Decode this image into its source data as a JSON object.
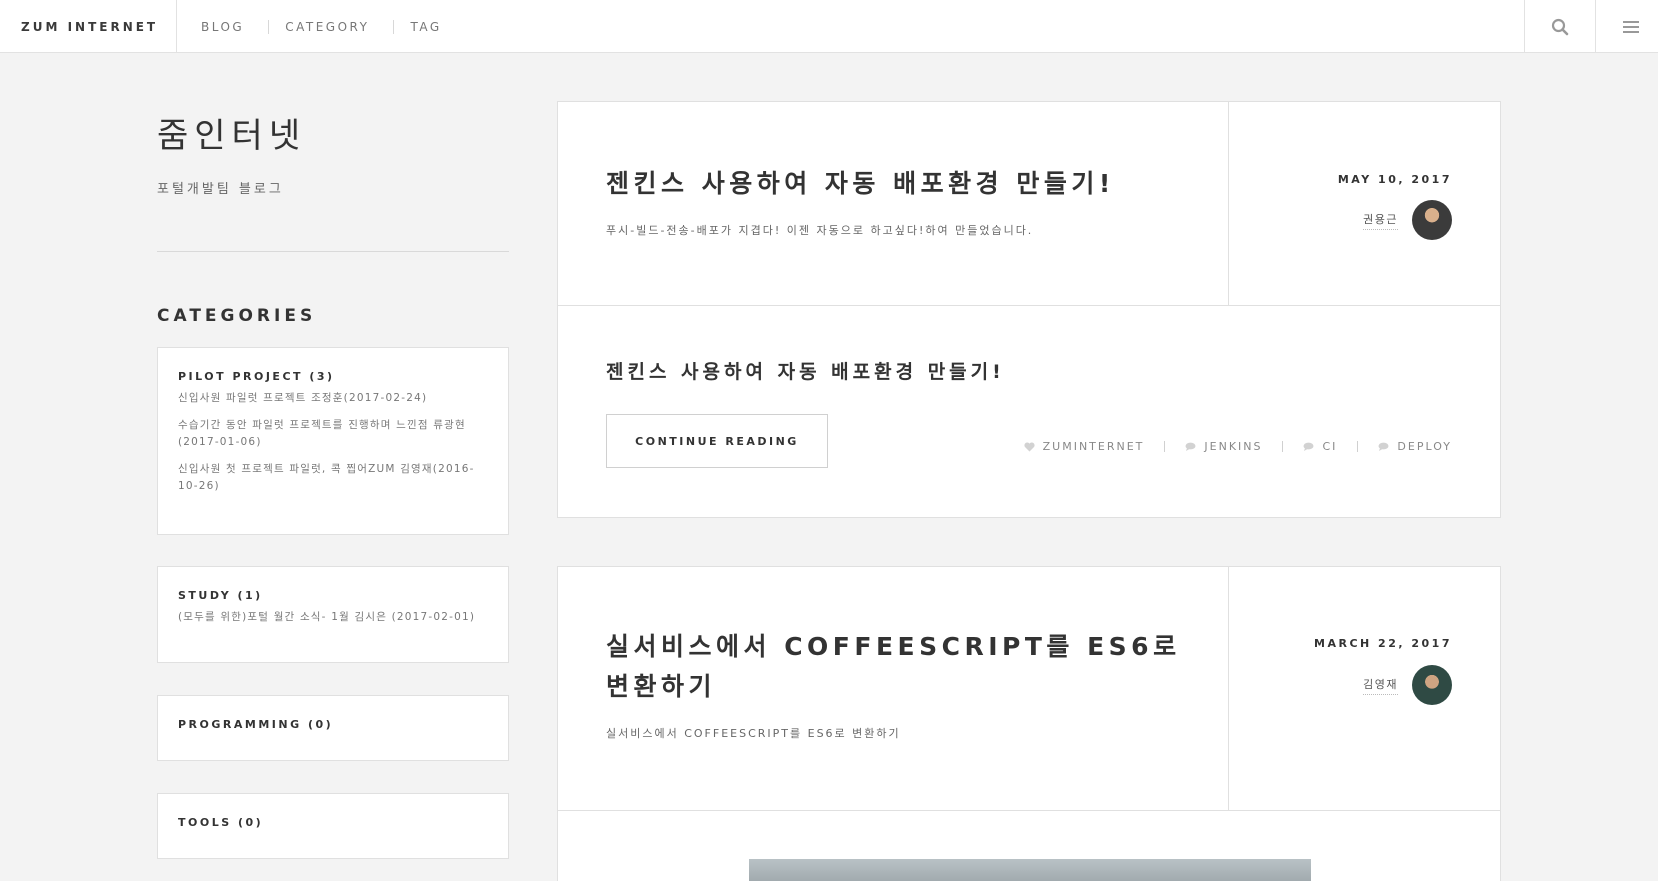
{
  "header": {
    "brand": "ZUM INTERNET",
    "nav": [
      "BLOG",
      "CATEGORY",
      "TAG"
    ]
  },
  "sidebar": {
    "title": "줌인터넷",
    "description": "포털개발팀 블로그",
    "categories_heading": "CATEGORIES",
    "categories": [
      {
        "name": "PILOT PROJECT (3)",
        "posts": [
          "신입사원 파일럿 프로젝트 조정훈(2017-02-24)",
          "수습기간 동안 파일럿 프로젝트를 진행하며 느낀점 류광현(2017-01-06)",
          "신입사원 첫 프로젝트 파일럿, 콕 찝어ZUM 김영재(2016-10-26)"
        ]
      },
      {
        "name": "STUDY (1)",
        "posts": [
          "(모두를 위한)포털 월간 소식- 1월 김시은 (2017-02-01)"
        ]
      },
      {
        "name": "PROGRAMMING (0)",
        "posts": []
      },
      {
        "name": "TOOLS (0)",
        "posts": []
      }
    ]
  },
  "posts": [
    {
      "title": "젠킨스 사용하여 자동 배포환경 만들기!",
      "subtitle": "푸시-빌드-전송-배포가 지겹다! 이젠 자동으로 하고싶다!하여 만들었습니다.",
      "date": "MAY 10, 2017",
      "author": "권용근",
      "excerpt_title": "젠킨스 사용하여 자동 배포환경 만들기!",
      "continue_label": "CONTINUE READING",
      "tags": [
        "ZUMINTERNET",
        "JENKINS",
        "CI",
        "DEPLOY"
      ]
    },
    {
      "title_line1": "실서비스에서 COFFEESCRIPT를 ES6로",
      "title_line2": "변환하기",
      "subtitle": "실서비스에서 COFFEESCRIPT를 ES6로 변환하기",
      "date": "MARCH 22, 2017",
      "author": "김영재"
    }
  ],
  "icons": {
    "search": "search-icon",
    "menu": "hamburger-menu-icon",
    "heart": "heart-icon",
    "tag_bubble": "comment-bubble-icon"
  },
  "colors": {
    "background": "#f3f3f3",
    "card": "#ffffff",
    "text": "#3a3a3a",
    "muted": "#888888"
  }
}
